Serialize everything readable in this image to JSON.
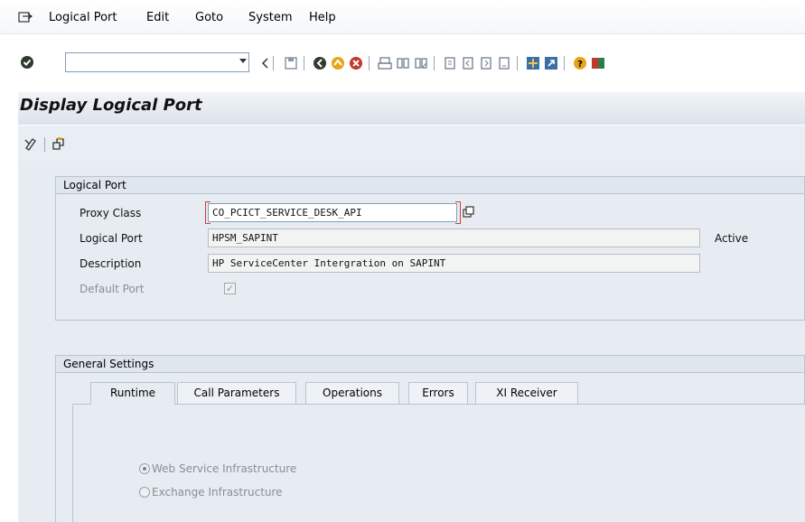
{
  "menu": {
    "items": [
      "Logical Port",
      "Edit",
      "Goto",
      "System",
      "Help"
    ]
  },
  "toolbar": {
    "command_value": "",
    "icons": [
      "enter-icon",
      "back-arrow-icon",
      "save-icon",
      "back-icon",
      "exit-icon",
      "cancel-icon",
      "print-icon",
      "find-icon",
      "find-next-icon",
      "first-page-icon",
      "previous-page-icon",
      "next-page-icon",
      "last-page-icon",
      "create-session-icon",
      "shortcut-icon",
      "help-icon",
      "customize-layout-icon"
    ]
  },
  "title": {
    "text": "Display Logical Port"
  },
  "app_toolbar": {
    "icons": [
      "display-change-icon",
      "other-object-icon"
    ]
  },
  "logical_port_group": {
    "title": "Logical Port",
    "proxy_class_label": "Proxy Class",
    "proxy_class_value": "CO_PCICT_SERVICE_DESK_API",
    "logical_port_label": "Logical Port",
    "logical_port_value": "HPSM_SAPINT",
    "status": "Active",
    "description_label": "Description",
    "description_value": "HP ServiceCenter Intergration on SAPINT",
    "default_port_label": "Default Port",
    "default_port_checked": true
  },
  "general_settings": {
    "title": "General Settings",
    "tabs": [
      "Runtime",
      "Call Parameters",
      "Operations",
      "Errors",
      "XI Receiver"
    ],
    "active_tab": "Runtime",
    "radio_options": [
      "Web Service Infrastructure",
      "Exchange Infrastructure"
    ],
    "selected_option": "Web Service Infrastructure"
  },
  "colors": {
    "title_band": "#dce3eb",
    "content_bg": "#e6ecf2",
    "focus_marker": "#d23b3b"
  }
}
